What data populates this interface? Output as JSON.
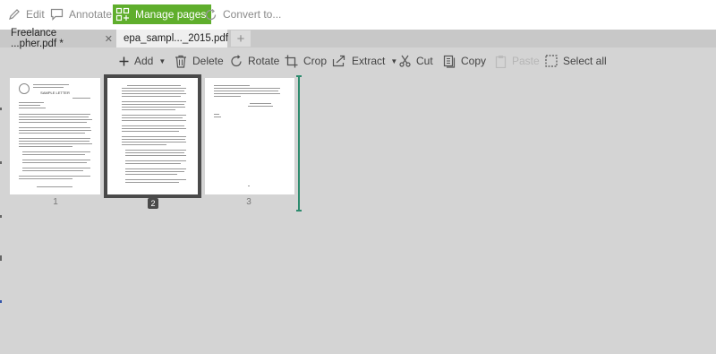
{
  "modes": [
    {
      "label": "Edit",
      "icon": "pencil-icon"
    },
    {
      "label": "Annotate",
      "icon": "comment-icon"
    },
    {
      "label": "Manage pages",
      "icon": "grid-pages-icon"
    },
    {
      "label": "Convert to...",
      "icon": "refresh-icon"
    }
  ],
  "tabs": [
    {
      "label": "Freelance ...pher.pdf *"
    },
    {
      "label": "epa_sampl..._2015.pdf"
    }
  ],
  "toolbar": {
    "add": "Add",
    "delete": "Delete",
    "rotate": "Rotate",
    "crop": "Crop",
    "extract": "Extract",
    "cut": "Cut",
    "copy": "Copy",
    "paste": "Paste",
    "select_all": "Select all"
  },
  "pages": [
    {
      "number": "1",
      "heading": "SAMPLE LETTER",
      "selected": false
    },
    {
      "number": "2",
      "selected": true
    },
    {
      "number": "3",
      "selected": false
    }
  ],
  "colors": {
    "accent": "#5fae2c",
    "insert_marker": "#2e8b6e",
    "selection": "#4a4a4a"
  }
}
